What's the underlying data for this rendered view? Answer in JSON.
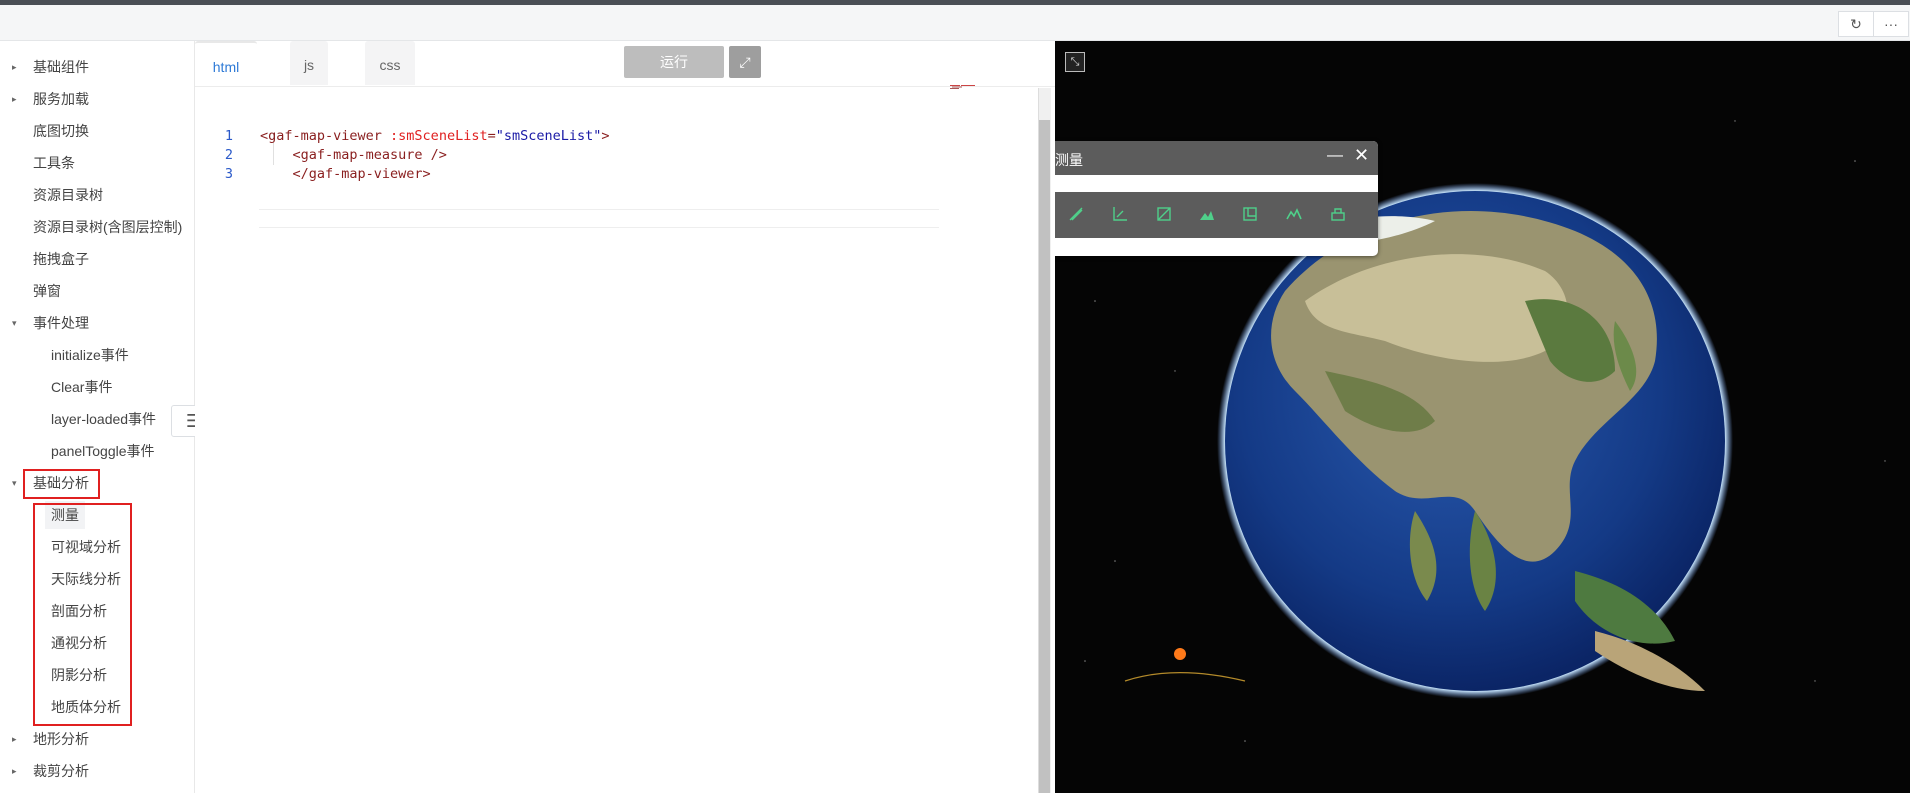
{
  "toolstrip": {
    "refresh_icon": "refresh-icon",
    "more_label": "···"
  },
  "sidebar": {
    "items": [
      {
        "label": "基础组件",
        "arrow": "▸"
      },
      {
        "label": "服务加载",
        "arrow": "▸"
      },
      {
        "label": "底图切换"
      },
      {
        "label": "工具条"
      },
      {
        "label": "资源目录树"
      },
      {
        "label": "资源目录树(含图层控制)"
      },
      {
        "label": "拖拽盒子"
      },
      {
        "label": "弹窗"
      },
      {
        "label": "事件处理",
        "arrow": "▾"
      },
      {
        "label": "initialize事件"
      },
      {
        "label": "Clear事件"
      },
      {
        "label": "layer-loaded事件"
      },
      {
        "label": "panelToggle事件"
      },
      {
        "label": "基础分析",
        "arrow": "▾"
      },
      {
        "label": "测量"
      },
      {
        "label": "可视域分析"
      },
      {
        "label": "天际线分析"
      },
      {
        "label": "剖面分析"
      },
      {
        "label": "通视分析"
      },
      {
        "label": "阴影分析"
      },
      {
        "label": "地质体分析"
      },
      {
        "label": "地形分析",
        "arrow": "▸"
      },
      {
        "label": "裁剪分析",
        "arrow": "▸"
      }
    ],
    "menu_toggle": "☰"
  },
  "editor": {
    "tabs": [
      {
        "label": "html"
      },
      {
        "label": "js"
      },
      {
        "label": "css"
      }
    ],
    "run_label": "运行",
    "code": [
      {
        "num": "1",
        "t1": "<gaf-map-viewer ",
        "t2": ":smSceneList",
        "t3": "=",
        "t4": "\"smSceneList\"",
        "t5": ">"
      },
      {
        "num": "2",
        "t1": "    <gaf-map-measure />"
      },
      {
        "num": "3",
        "t1": "    </gaf-map-viewer>"
      }
    ]
  },
  "map": {
    "panel": {
      "title": "测量",
      "min": "—",
      "close": "✕"
    }
  }
}
